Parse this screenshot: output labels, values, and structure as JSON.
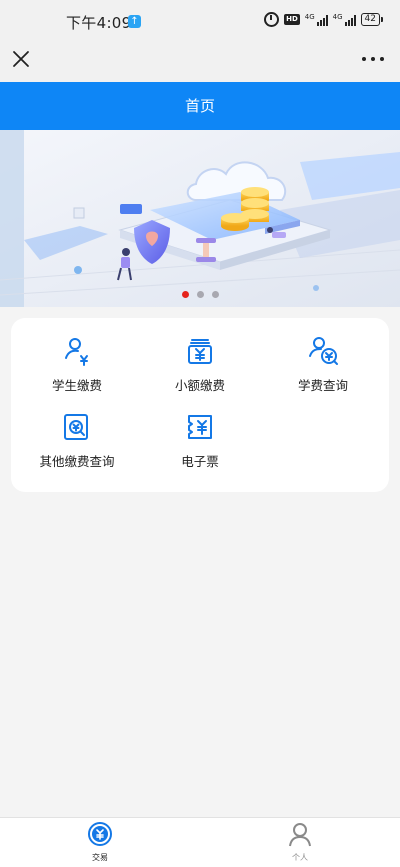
{
  "status_bar": {
    "time": "下午4:09",
    "network_label": "4G",
    "battery": "42"
  },
  "nav": {
    "close_icon": "close-icon",
    "more_icon": "more-dots-icon"
  },
  "header": {
    "title": "首页",
    "background": "#0e86f6"
  },
  "banner": {
    "slide_count": 3,
    "active_slide": 1,
    "active_dot_color": "#e5231c"
  },
  "services": {
    "accent_color": "#1478e6",
    "items": [
      {
        "label": "学生缴费",
        "icon": "student-pay-icon"
      },
      {
        "label": "小额缴费",
        "icon": "small-payment-icon"
      },
      {
        "label": "学费查询",
        "icon": "tuition-query-icon"
      },
      {
        "label": "其他缴费查询",
        "icon": "other-payment-query-icon"
      },
      {
        "label": "电子票",
        "icon": "e-ticket-icon"
      }
    ]
  },
  "tabbar": {
    "tabs": [
      {
        "label": "交易",
        "icon": "trade-icon",
        "active": true
      },
      {
        "label": "个人",
        "icon": "person-icon",
        "active": false
      }
    ]
  }
}
